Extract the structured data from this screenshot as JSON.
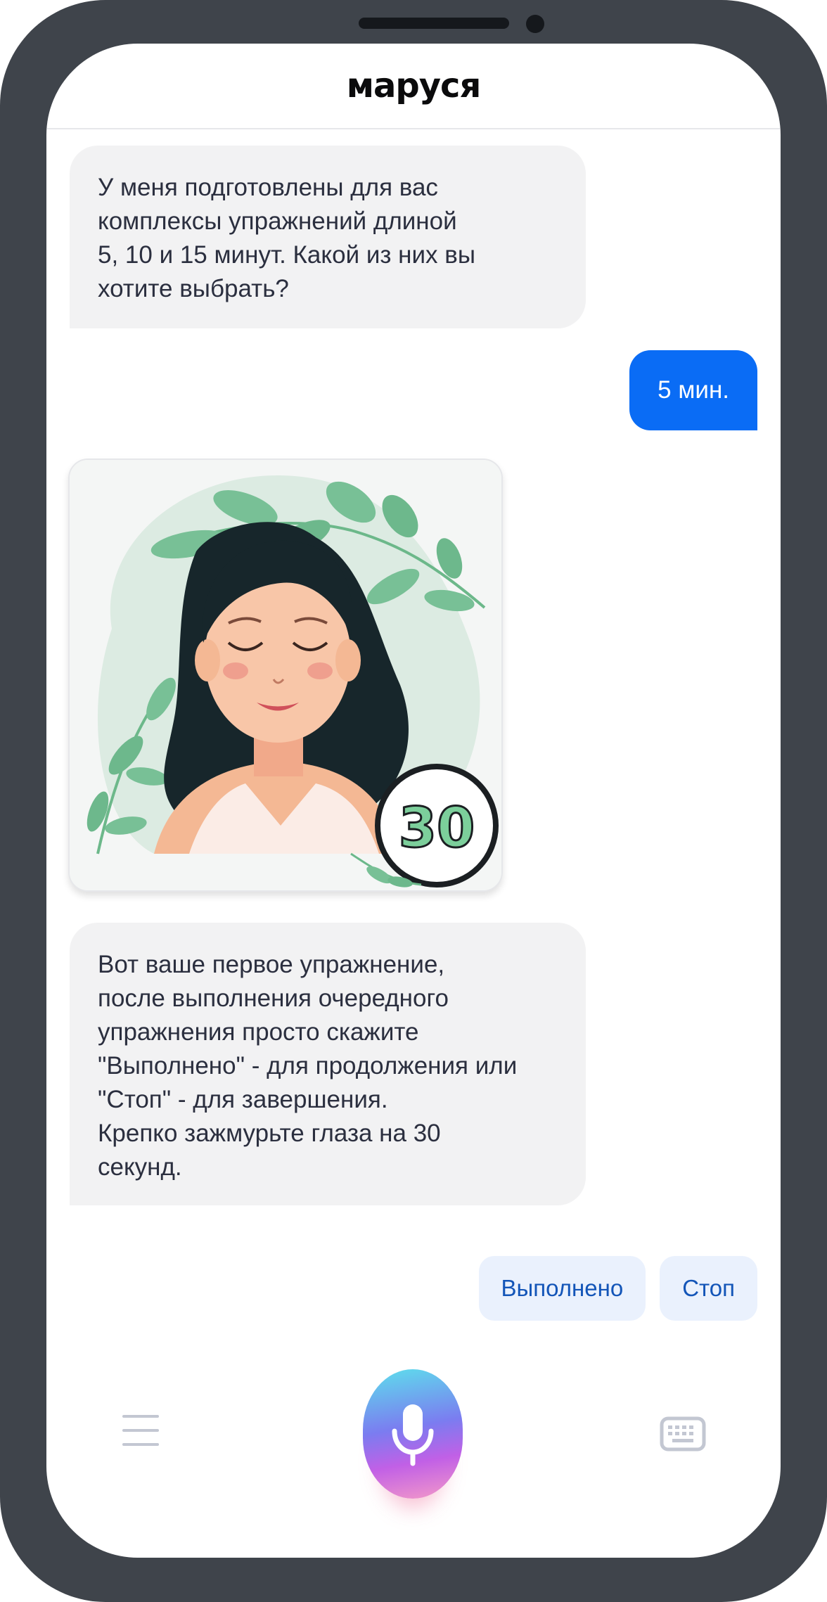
{
  "app": {
    "title": "маруся"
  },
  "chat": {
    "message_1": "У меня подготовлены для вас\nкомплексы упражнений длиной\n5, 10 и 15 минут. Какой из них вы\nхотите выбрать?",
    "user_reply": "5 мин.",
    "image_card": {
      "badge_number": "30",
      "image_alt": "illustration of a woman with closed eyes"
    },
    "message_2": "Вот ваше первое упражнение,\nпосле выполнения очередного\nупражнения просто скажите\n\"Выполнено\" - для продолжения или\n\"Стоп\" - для завершения.\nКрепко зажмурьте глаза на 30\nсекунд."
  },
  "quick_replies": [
    {
      "label": "Выполнено"
    },
    {
      "label": "Стоп"
    }
  ],
  "bottom_bar": {
    "menu_icon": "hamburger-menu-icon",
    "mic_icon": "microphone-icon",
    "keyboard_icon": "keyboard-icon"
  },
  "colors": {
    "frame": "#3f444b",
    "accent_blue": "#0a6cf5",
    "bubble_gray": "#f2f2f3",
    "quick_reply_bg": "#eaf1fd",
    "quick_reply_text": "#1355b8"
  }
}
